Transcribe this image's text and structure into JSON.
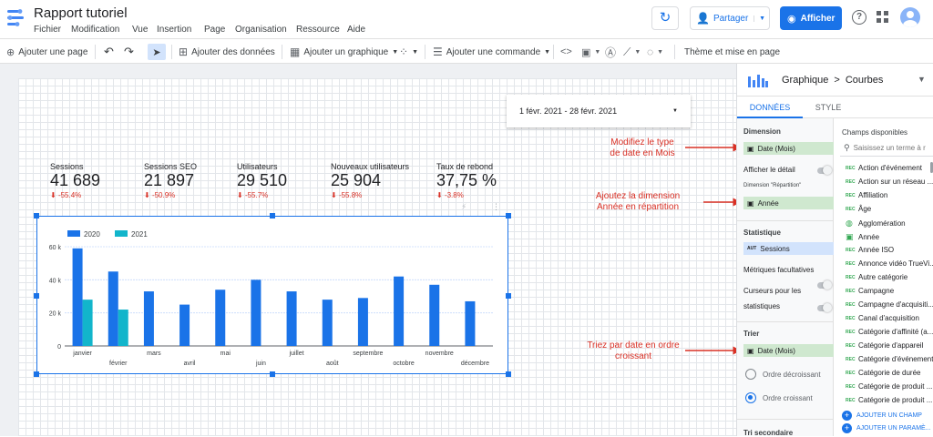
{
  "app": {
    "title": "Rapport tutoriel"
  },
  "menu": [
    "Fichier",
    "Modification",
    "Vue",
    "Insertion",
    "Page",
    "Organisation",
    "Ressource",
    "Aide"
  ],
  "header": {
    "share_label": "Partager",
    "view_label": "Afficher"
  },
  "toolbar": {
    "add_page": "Ajouter une page",
    "add_data": "Ajouter des données",
    "add_chart": "Ajouter un graphique",
    "add_control": "Ajouter une commande",
    "theme": "Thème et mise en page"
  },
  "date_range": {
    "value": "1 févr. 2021 - 28 févr. 2021"
  },
  "kpis": [
    {
      "label": "Sessions",
      "value": "41 689",
      "delta": "-55.4%"
    },
    {
      "label": "Sessions SEO",
      "value": "21 897",
      "delta": "-50.9%"
    },
    {
      "label": "Utilisateurs",
      "value": "29 510",
      "delta": "-55.7%"
    },
    {
      "label": "Nouveaux utilisateurs",
      "value": "25 904",
      "delta": "-55.8%"
    },
    {
      "label": "Taux de rebond",
      "value": "37,75 %",
      "delta": "-3.8%"
    }
  ],
  "chart_data": {
    "type": "bar",
    "categories": [
      "janvier",
      "février",
      "mars",
      "avril",
      "mai",
      "juin",
      "juillet",
      "août",
      "septembre",
      "octobre",
      "novembre",
      "décembre"
    ],
    "series": [
      {
        "name": "2020",
        "color": "#1a73e8",
        "values": [
          59000,
          45000,
          33000,
          25000,
          34000,
          40000,
          33000,
          28000,
          29000,
          42000,
          37000,
          27000
        ]
      },
      {
        "name": "2021",
        "color": "#12b5cb",
        "values": [
          28000,
          22000,
          null,
          null,
          null,
          null,
          null,
          null,
          null,
          null,
          null,
          null
        ]
      }
    ],
    "ylim": [
      0,
      60000
    ],
    "yticks": [
      "0",
      "20 k",
      "40 k",
      "60 k"
    ],
    "legend": "top-left",
    "grid": true
  },
  "panel": {
    "breadcrumb_root": "Graphique",
    "breadcrumb_sep": ">",
    "breadcrumb_leaf": "Courbes",
    "tab_data": "DONNÉES",
    "tab_style": "STYLE",
    "dimension_label": "Dimension",
    "dimension_value": "Date (Mois)",
    "show_detail": "Afficher le détail",
    "breakdown_label": "Dimension \"Répartition\"",
    "breakdown_value": "Année",
    "metric_label": "Statistique",
    "metric_badge": "AUT",
    "metric_value": "Sessions",
    "optional_metrics": "Métriques facultatives",
    "metric_sliders_1": "Curseurs pour les",
    "metric_sliders_2": "statistiques",
    "sort_label": "Trier",
    "sort_value": "Date (Mois)",
    "sort_desc": "Ordre décroissant",
    "sort_asc": "Ordre croissant",
    "secondary_sort": "Tri secondaire",
    "fields_title": "Champs disponibles",
    "search_placeholder": "Saisissez un terme à r",
    "fields": [
      {
        "type": "ABC",
        "label": "Action d'événement"
      },
      {
        "type": "ABC",
        "label": "Action sur un réseau ..."
      },
      {
        "type": "ABC",
        "label": "Affiliation"
      },
      {
        "type": "ABC",
        "label": "Âge"
      },
      {
        "type": "GEO",
        "label": "Agglomération"
      },
      {
        "type": "DATE",
        "label": "Année"
      },
      {
        "type": "ABC",
        "label": "Année ISO"
      },
      {
        "type": "ABC",
        "label": "Annonce vidéo TrueVi..."
      },
      {
        "type": "ABC",
        "label": "Autre catégorie"
      },
      {
        "type": "ABC",
        "label": "Campagne"
      },
      {
        "type": "ABC",
        "label": "Campagne d'acquisiti..."
      },
      {
        "type": "ABC",
        "label": "Canal d'acquisition"
      },
      {
        "type": "ABC",
        "label": "Catégorie d'affinité (a..."
      },
      {
        "type": "ABC",
        "label": "Catégorie d'appareil"
      },
      {
        "type": "ABC",
        "label": "Catégorie d'événement"
      },
      {
        "type": "ABC",
        "label": "Catégorie de durée"
      },
      {
        "type": "ABC",
        "label": "Catégorie de produit ..."
      },
      {
        "type": "ABC",
        "label": "Catégorie de produit ..."
      }
    ],
    "add_field": "AJOUTER UN CHAMP",
    "add_param": "AJOUTER UN PARAMÈ..."
  },
  "annotations": {
    "a1_line1": "Modifiez le type",
    "a1_line2": "de date en Mois",
    "a2_line1": "Ajoutez la dimension",
    "a2_line2": "Année en répartition",
    "a3_line1": "Triez par date en ordre",
    "a3_line2": "croissant"
  }
}
